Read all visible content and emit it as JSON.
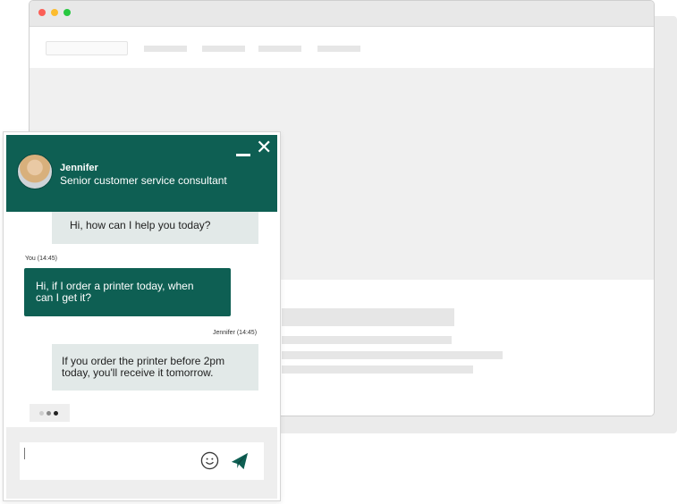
{
  "chat": {
    "agent": {
      "name": "Jennifer",
      "role": "Senior customer service consultant"
    },
    "header_controls": {
      "minimize_icon": "minimize-icon",
      "close_icon": "close-icon",
      "close_glyph": "✕"
    },
    "messages": [
      {
        "sender": "agent",
        "text": "Hi, how can I help you today?"
      },
      {
        "sender": "user",
        "meta": "You (14:45)",
        "text": "Hi, if I order a printer today, when\ncan I get it?"
      },
      {
        "sender": "agent",
        "meta": "Jennifer (14:45)",
        "text": "If you order the printer before 2pm\ntoday, you'll receive it tomorrow."
      }
    ],
    "composer": {
      "input_value": "",
      "emoji_icon": "smiley-icon",
      "send_icon": "paper-plane-icon"
    }
  },
  "colors": {
    "brand": "#0e5f53",
    "agent_bubble": "#e2e9e8",
    "typing_dots": [
      "#cccccc",
      "#888888",
      "#222222"
    ]
  }
}
